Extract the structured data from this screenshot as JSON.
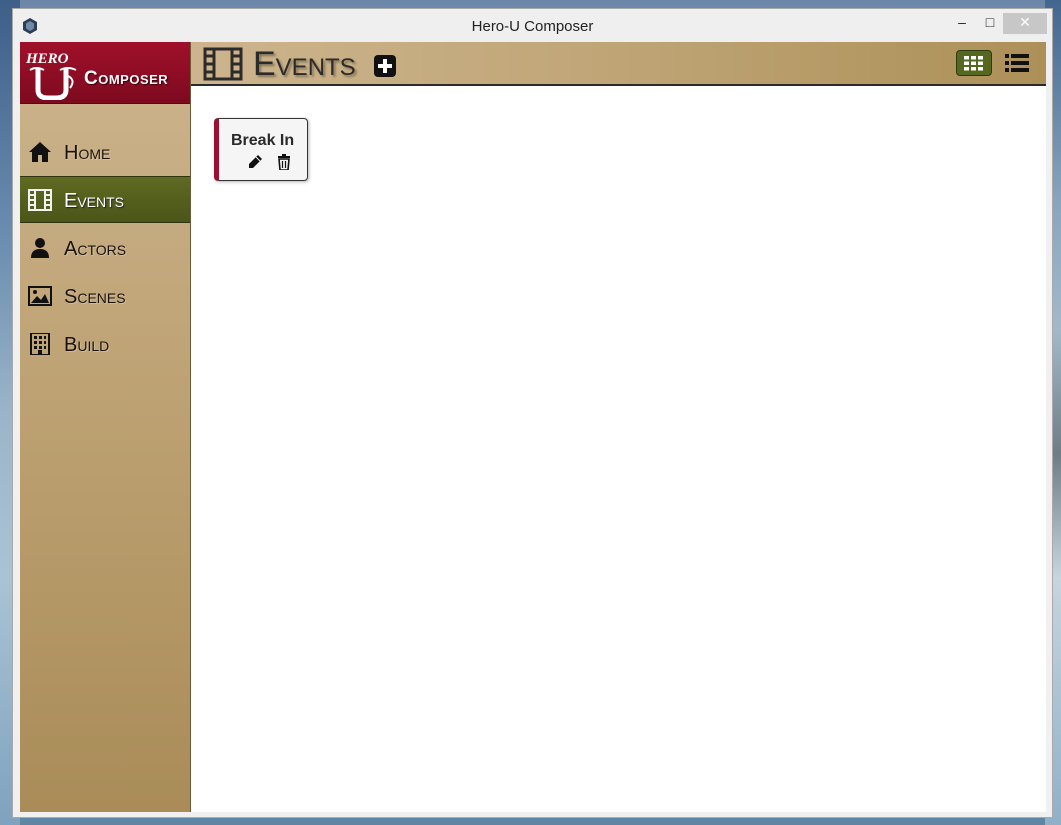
{
  "window": {
    "title": "Hero-U Composer",
    "controls": {
      "minimize": "–",
      "maximize": "□",
      "close": "✕"
    }
  },
  "logo": {
    "word": "Composer"
  },
  "sidebar": {
    "items": [
      {
        "label": "Home",
        "icon": "home-icon"
      },
      {
        "label": "Events",
        "icon": "film-icon",
        "active": true
      },
      {
        "label": "Actors",
        "icon": "user-icon"
      },
      {
        "label": "Scenes",
        "icon": "image-icon"
      },
      {
        "label": "Build",
        "icon": "building-icon"
      }
    ]
  },
  "header": {
    "title": "Events",
    "icon": "film-icon",
    "add_icon": "plus-square-icon",
    "view_modes": [
      "grid-view-icon",
      "list-view-icon"
    ],
    "active_view": "grid"
  },
  "events": [
    {
      "title": "Break In",
      "accent": "#9b1030"
    }
  ],
  "colors": {
    "brand": "#9b1030",
    "sidebar": "#b89c6b",
    "active_nav": "#56621d"
  }
}
